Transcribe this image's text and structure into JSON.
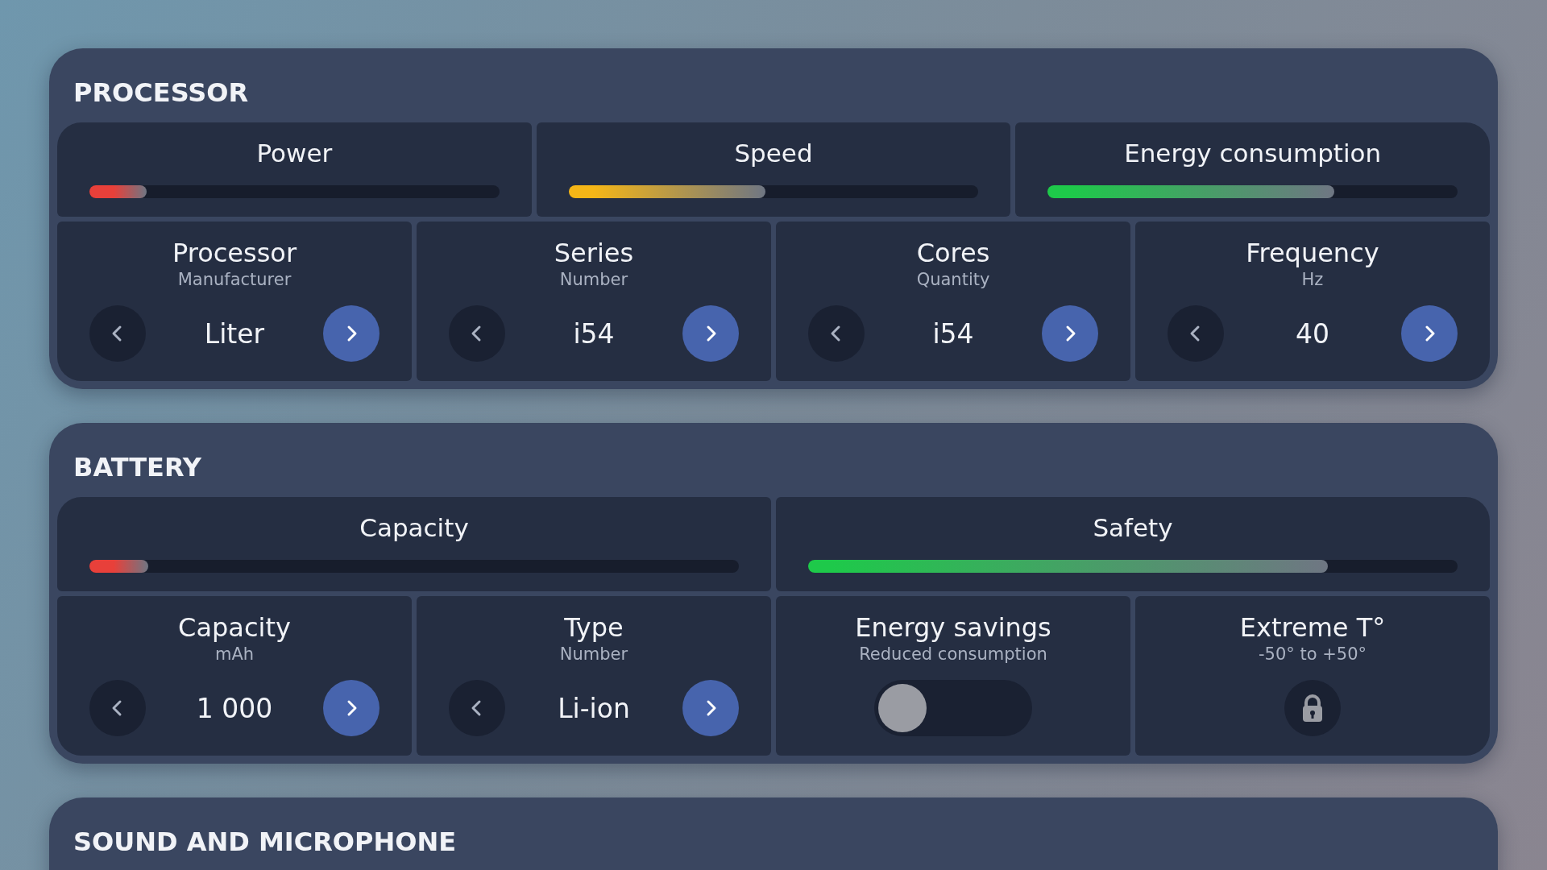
{
  "sections": [
    {
      "title": "PROCESSOR",
      "meters": [
        {
          "label": "Power",
          "level": 0.14,
          "color": "#e8403a"
        },
        {
          "label": "Speed",
          "level": 0.48,
          "color": "#f5b617"
        },
        {
          "label": "Energy consumption",
          "level": 0.7,
          "color": "#1ec94a"
        }
      ],
      "controls": [
        {
          "kind": "stepper",
          "title": "Processor",
          "subtitle": "Manufacturer",
          "value": "Liter"
        },
        {
          "kind": "stepper",
          "title": "Series",
          "subtitle": "Number",
          "value": "i54"
        },
        {
          "kind": "stepper",
          "title": "Cores",
          "subtitle": "Quantity",
          "value": "i54"
        },
        {
          "kind": "stepper",
          "title": "Frequency",
          "subtitle": "Hz",
          "value": "40"
        }
      ]
    },
    {
      "title": "BATTERY",
      "meters": [
        {
          "label": "Capacity",
          "level": 0.09,
          "color": "#e8403a"
        },
        {
          "label": "Safety",
          "level": 0.8,
          "color": "#1ec94a"
        }
      ],
      "controls": [
        {
          "kind": "stepper",
          "title": "Capacity",
          "subtitle": "mAh",
          "value": "1 000"
        },
        {
          "kind": "stepper",
          "title": "Type",
          "subtitle": "Number",
          "value": "Li-ion"
        },
        {
          "kind": "toggle",
          "title": "Energy savings",
          "subtitle": "Reduced consumption",
          "on": false
        },
        {
          "kind": "lock",
          "title": "Extreme T°",
          "subtitle": "-50° to +50°"
        }
      ]
    },
    {
      "title": "SOUND AND MICROPHONE"
    }
  ]
}
